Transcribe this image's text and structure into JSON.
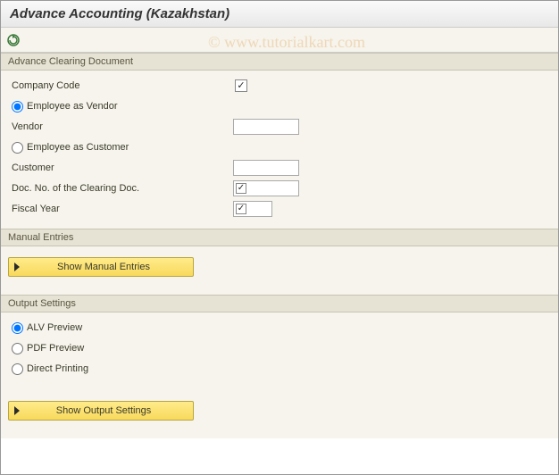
{
  "title": "Advance Accounting (Kazakhstan)",
  "watermark": "© www.tutorialkart.com",
  "toolbar": {
    "execute_icon": "execute"
  },
  "sections": {
    "clearing": {
      "header": "Advance Clearing Document",
      "company_code_label": "Company Code",
      "company_code_checked": true,
      "employee_vendor_label": "Employee as Vendor",
      "employee_vendor_selected": true,
      "vendor_label": "Vendor",
      "vendor_value": "",
      "employee_customer_label": "Employee as Customer",
      "employee_customer_selected": false,
      "customer_label": "Customer",
      "customer_value": "",
      "doc_no_label": "Doc. No. of the Clearing Doc.",
      "doc_no_checked": true,
      "doc_no_value": "",
      "fiscal_year_label": "Fiscal Year",
      "fiscal_year_checked": true,
      "fiscal_year_value": ""
    },
    "manual": {
      "header": "Manual Entries",
      "button": "Show Manual Entries"
    },
    "output": {
      "header": "Output Settings",
      "alv_label": "ALV Preview",
      "alv_selected": true,
      "pdf_label": "PDF Preview",
      "pdf_selected": false,
      "direct_label": "Direct Printing",
      "direct_selected": false,
      "button": "Show Output Settings"
    }
  }
}
